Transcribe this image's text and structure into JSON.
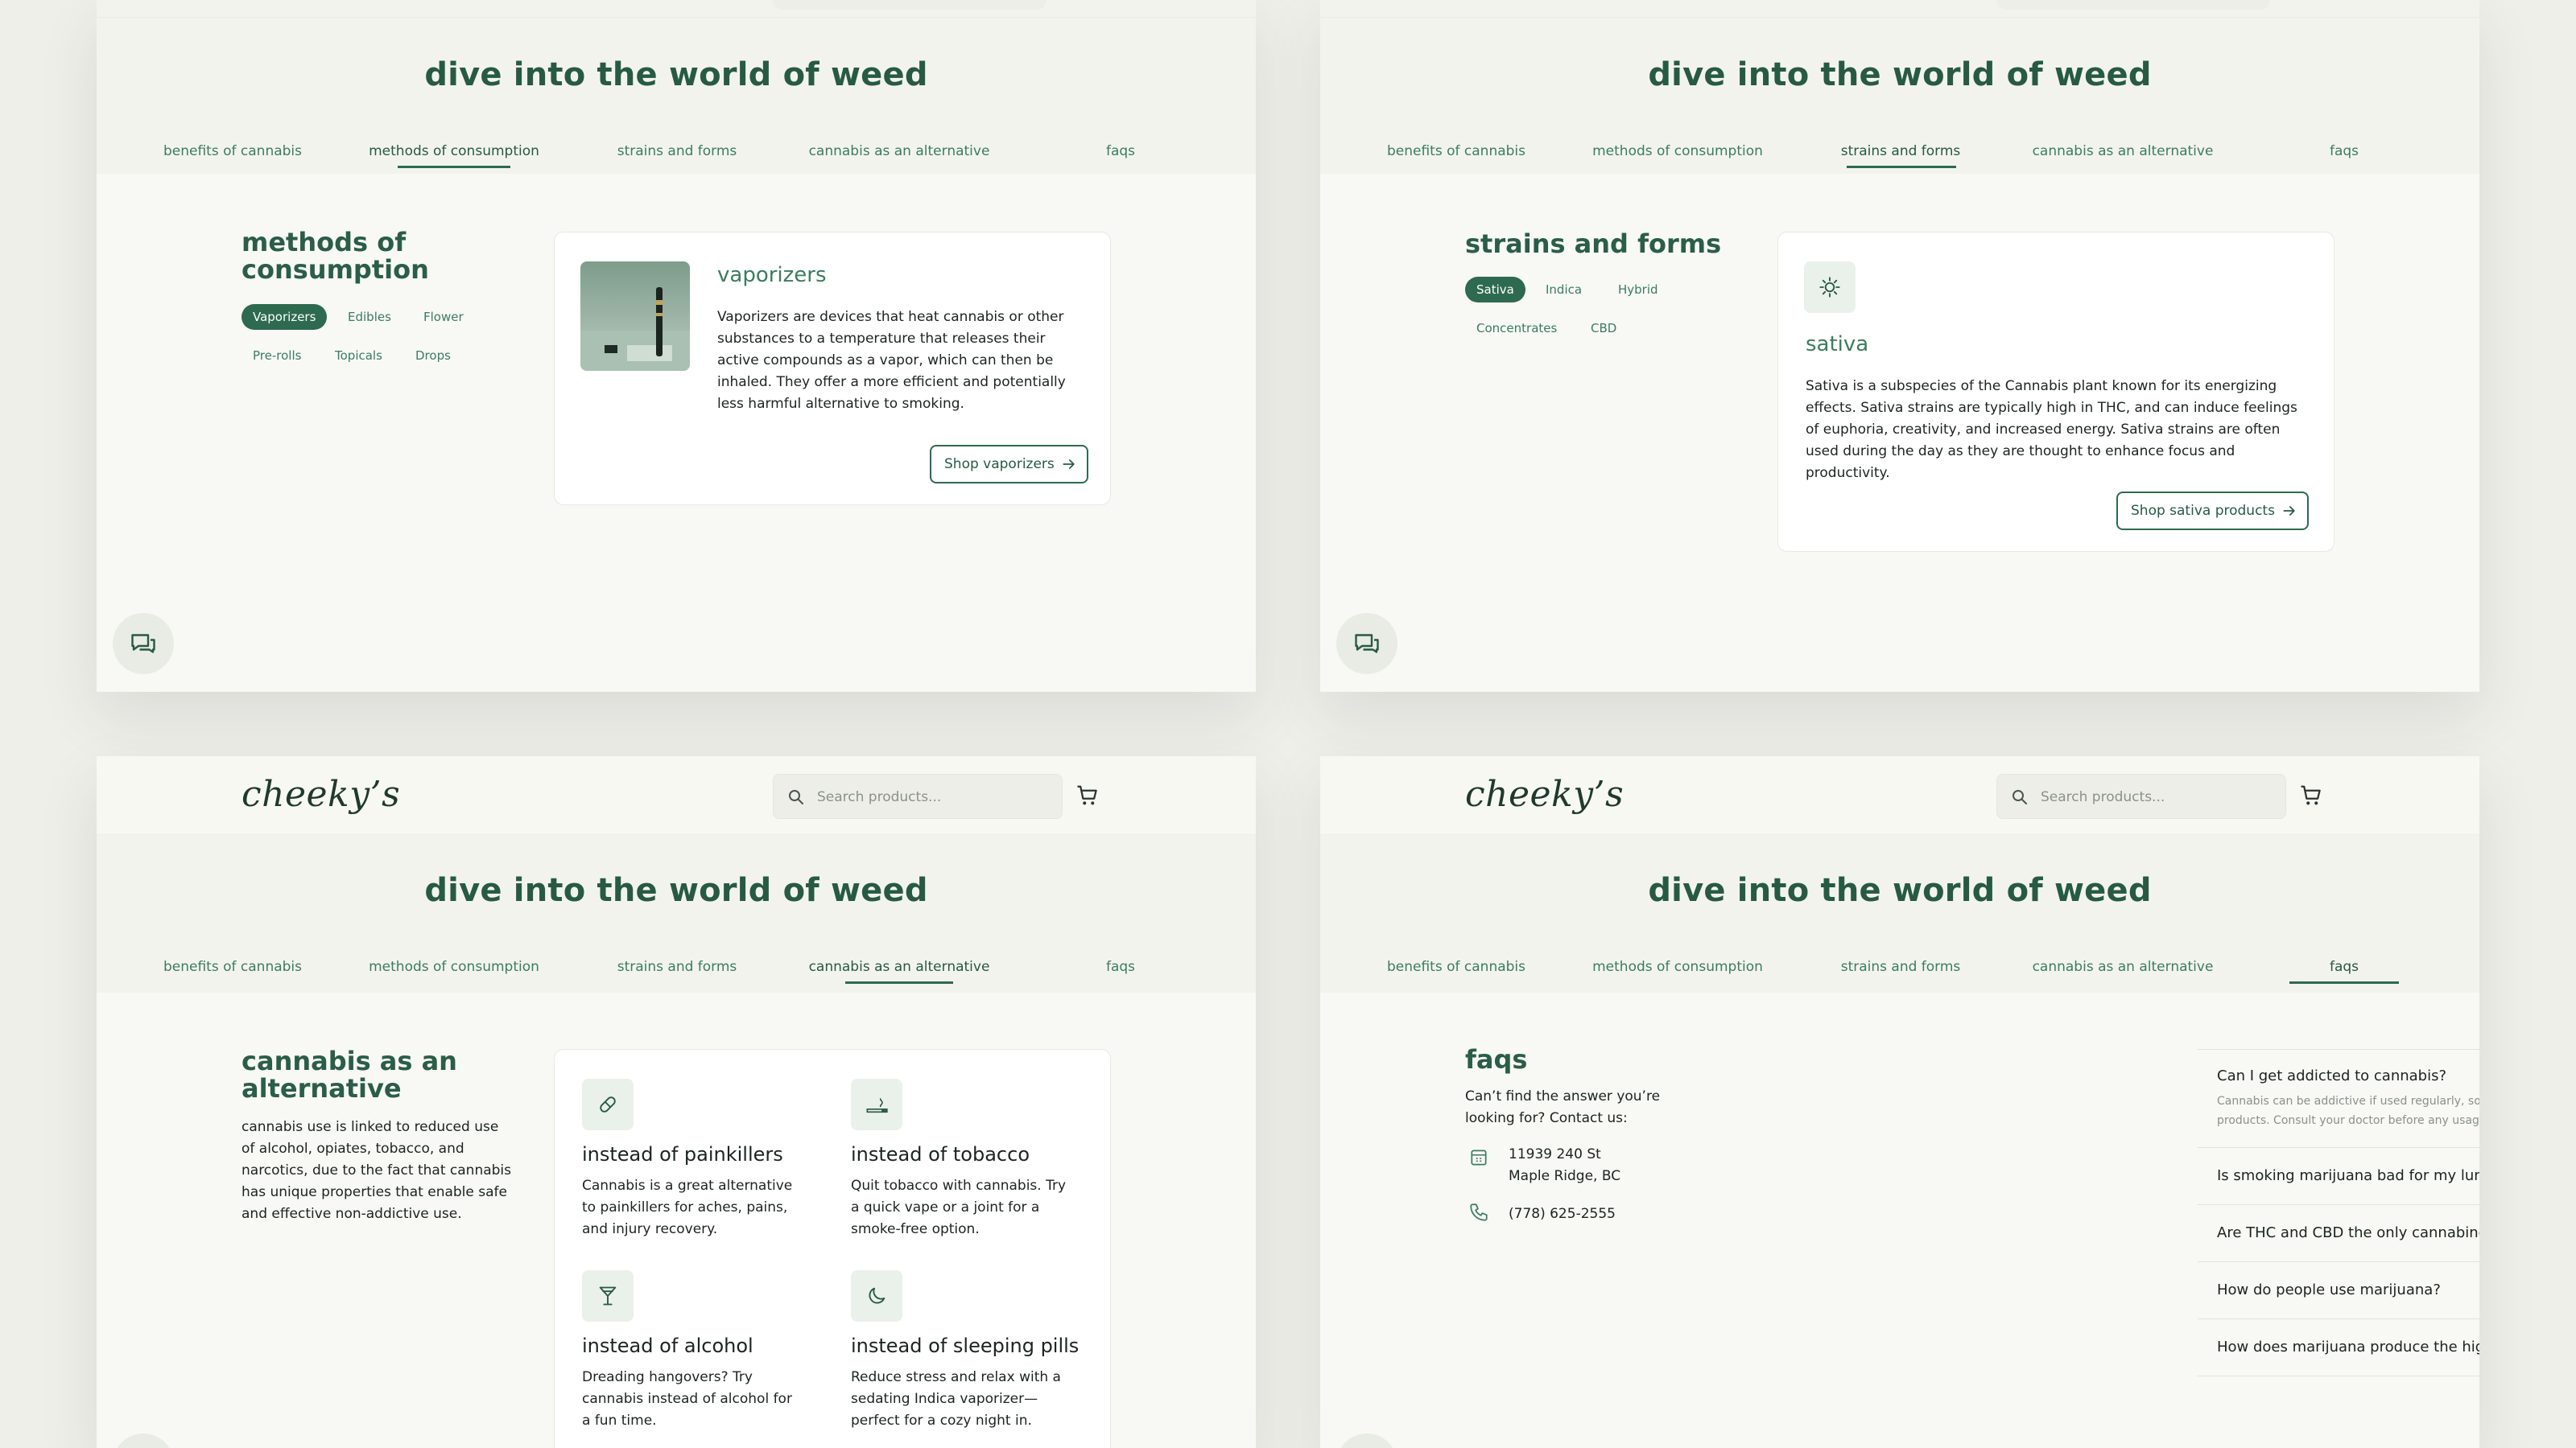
{
  "brand": {
    "logo": "cheeky’s"
  },
  "header": {
    "search_placeholder": "Search products..."
  },
  "hero": {
    "title": "dive into the world of weed",
    "tabs": [
      "benefits of cannabis",
      "methods of consumption",
      "strains and forms",
      "cannabis as an alternative",
      "faqs"
    ]
  },
  "methods": {
    "title": "methods of consumption",
    "chips": [
      "Vaporizers",
      "Edibles",
      "Flower",
      "Pre-rolls",
      "Topicals",
      "Drops"
    ],
    "active_chip": "Vaporizers",
    "card_title": "vaporizers",
    "card_body": "Vaporizers are devices that heat cannabis or other substances to a temperature that releases their active compounds as a vapor, which can then be inhaled. They offer a more efficient and potentially less harmful alternative to smoking.",
    "button": "Shop vaporizers"
  },
  "strains": {
    "title": "strains and forms",
    "chips": [
      "Sativa",
      "Indica",
      "Hybrid",
      "Concentrates",
      "CBD"
    ],
    "active_chip": "Sativa",
    "card_title": "sativa",
    "card_body": "Sativa is a subspecies of the Cannabis plant known for its energizing effects. Sativa strains are typically high in THC, and can induce feelings of euphoria, creativity, and increased energy. Sativa strains are often used during the day as they are thought to enhance focus and productivity.",
    "button": "Shop sativa products"
  },
  "alternative": {
    "title": "cannabis as an alternative",
    "intro": "cannabis use is linked to reduced use of alcohol, opiates, tobacco, and narcotics, due to the fact that cannabis has unique properties that enable safe and effective non-addictive use.",
    "items": [
      {
        "title": "instead of painkillers",
        "body": "Cannabis is a great alternative to painkillers for aches, pains, and injury recovery.",
        "icon": "pill-icon"
      },
      {
        "title": "instead of tobacco",
        "body": "Quit tobacco with cannabis. Try a quick vape or a joint for a smoke-free option.",
        "icon": "smoking-icon"
      },
      {
        "title": "instead of alcohol",
        "body": "Dreading hangovers? Try cannabis instead of alcohol for a fun time.",
        "icon": "cocktail-icon"
      },
      {
        "title": "instead of sleeping pills",
        "body": "Reduce stress and relax with a sedating Indica vaporizer—perfect for a cozy night in.",
        "icon": "moon-icon"
      }
    ]
  },
  "faqs": {
    "title": "faqs",
    "subtitle": "Can’t find the answer you’re looking for? Contact us:",
    "address_line1": "11939 240 St",
    "address_line2": "Maple Ridge, BC",
    "phone": "(778) 625-2555",
    "items": [
      {
        "q": "Can I get addicted to cannabis?",
        "a": "Cannabis can be addictive if used regularly, so proceed with caution when using any cannabis products. Consult your doctor before any usage of marijuana for medical use.",
        "open": true
      },
      {
        "q": "Is smoking marijuana bad for my lungs?",
        "open": false
      },
      {
        "q": "Are THC and CBD the only cannabinoids?",
        "open": false
      },
      {
        "q": "How do people use marijuana?",
        "open": false
      },
      {
        "q": "How does marijuana produce the high?",
        "open": false
      }
    ]
  },
  "colors": {
    "accent": "#2d6a4f",
    "heading": "#275a43",
    "tab": "#3b7d5f",
    "page": "#f8f8f4",
    "hero": "#f3f3ee"
  }
}
